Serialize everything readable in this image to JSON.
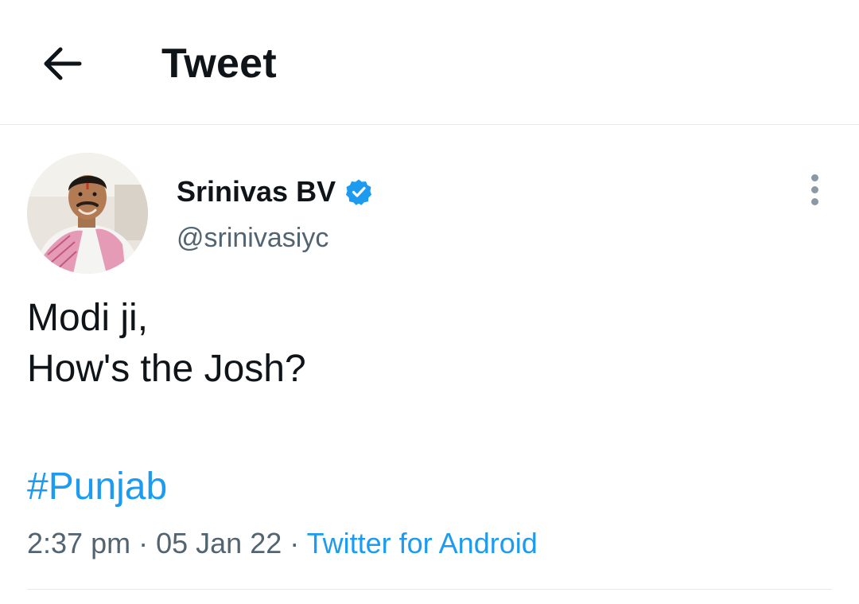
{
  "header": {
    "back_icon": "arrow-left-icon",
    "title": "Tweet"
  },
  "tweet": {
    "author": {
      "display_name": "Srinivas BV",
      "handle": "@srinivasiyc",
      "verified": true,
      "verified_icon": "verified-badge-icon",
      "avatar_icon": "profile-photo"
    },
    "more_icon": "more-vertical-icon",
    "text_lines": [
      "Modi ji,",
      "How's the Josh?"
    ],
    "hashtag": "#Punjab",
    "time": "2:37 pm",
    "separator": "·",
    "date": "05 Jan 22",
    "source": "Twitter for Android"
  },
  "colors": {
    "link": "#1d9bf0",
    "secondary_text": "#536471",
    "primary_text": "#0f1419",
    "divider": "#e6e9ec"
  }
}
